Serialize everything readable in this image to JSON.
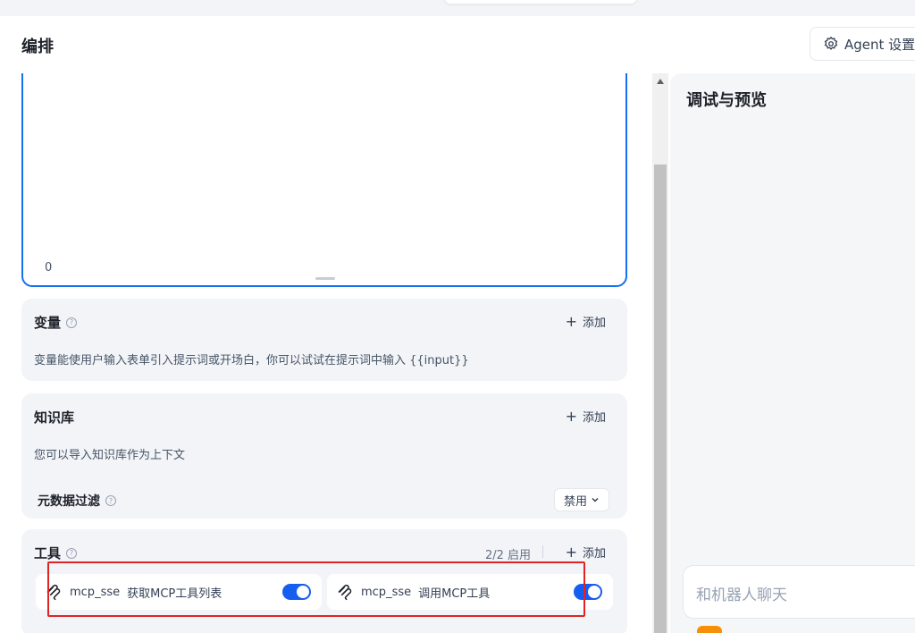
{
  "header": {
    "title": "编排",
    "agent_settings_label": "Agent 设置"
  },
  "prompt": {
    "char_count": "0"
  },
  "variables": {
    "title": "变量",
    "add_label": "添加",
    "description": "变量能使用户输入表单引入提示词或开场白，你可以试试在提示词中输入 {{input}}"
  },
  "knowledge": {
    "title": "知识库",
    "add_label": "添加",
    "description": "您可以导入知识库作为上下文",
    "metadata_filter_label": "元数据过滤",
    "metadata_filter_value": "禁用"
  },
  "tools": {
    "title": "工具",
    "status": "2/2 启用",
    "add_label": "添加",
    "items": [
      {
        "name": "mcp_sse",
        "description": "获取MCP工具列表",
        "enabled": true,
        "icon": "mcp-icon"
      },
      {
        "name": "mcp_sse",
        "description": "调用MCP工具",
        "enabled": true,
        "icon": "mcp-icon"
      }
    ]
  },
  "preview": {
    "title": "调试与预览",
    "chat_placeholder": "和机器人聊天"
  },
  "colors": {
    "accent": "#155eef",
    "highlight_box": "#e02424"
  }
}
